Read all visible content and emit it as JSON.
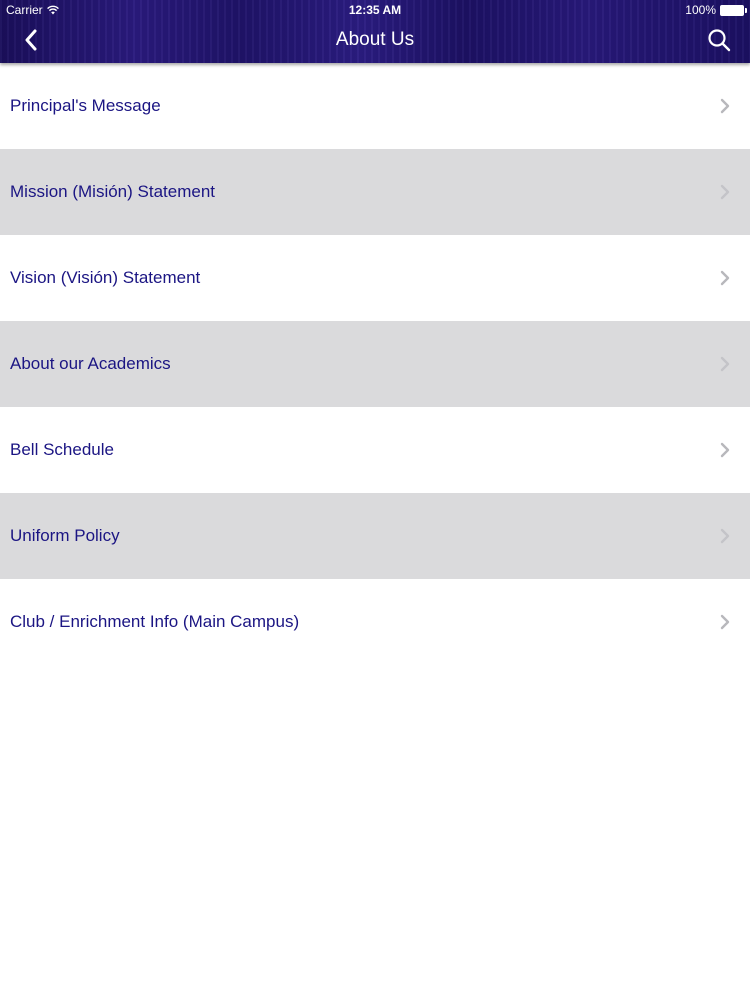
{
  "status_bar": {
    "carrier": "Carrier",
    "time": "12:35 AM",
    "battery": "100%"
  },
  "nav": {
    "title": "About Us",
    "back_icon": "chevron-left-icon",
    "search_icon": "search-icon"
  },
  "menu": {
    "items": [
      {
        "label": "Principal's Message"
      },
      {
        "label": "Mission (Misión) Statement"
      },
      {
        "label": "Vision (Visión) Statement"
      },
      {
        "label": "About our Academics"
      },
      {
        "label": "Bell Schedule"
      },
      {
        "label": "Uniform Policy"
      },
      {
        "label": "Club / Enrichment Info (Main Campus)"
      }
    ]
  },
  "colors": {
    "header": "#221570",
    "item_text": "#1b1583",
    "alt_row": "#dadadc",
    "chevron": "#b8b8bc"
  }
}
